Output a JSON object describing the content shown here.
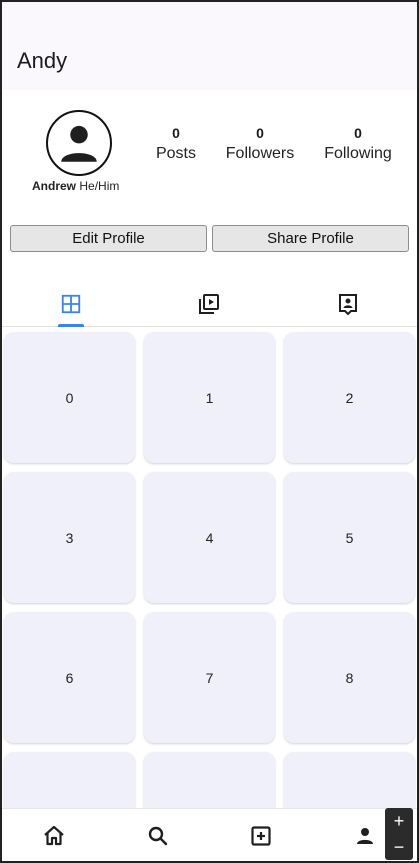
{
  "app_bar": {
    "title": "Andy"
  },
  "profile": {
    "name": "Andrew",
    "pronouns": "He/Him",
    "stats": [
      {
        "value": "0",
        "label": "Posts"
      },
      {
        "value": "0",
        "label": "Followers"
      },
      {
        "value": "0",
        "label": "Following"
      }
    ]
  },
  "actions": {
    "edit_label": "Edit Profile",
    "share_label": "Share Profile"
  },
  "tabs": [
    {
      "icon": "grid-icon",
      "active": true
    },
    {
      "icon": "video-library-icon",
      "active": false
    },
    {
      "icon": "tagged-user-icon",
      "active": false
    }
  ],
  "grid": {
    "items": [
      "0",
      "1",
      "2",
      "3",
      "4",
      "5",
      "6",
      "7",
      "8",
      "",
      "",
      ""
    ]
  },
  "bottom_nav": [
    {
      "icon": "home-icon"
    },
    {
      "icon": "search-icon"
    },
    {
      "icon": "add-box-icon"
    },
    {
      "icon": "person-icon"
    }
  ],
  "zoom": {
    "plus": "+",
    "minus": "−"
  },
  "colors": {
    "accent": "#3b82f6",
    "tile": "#f0f0fa",
    "app_bar_bg": "#fbf8fd"
  }
}
